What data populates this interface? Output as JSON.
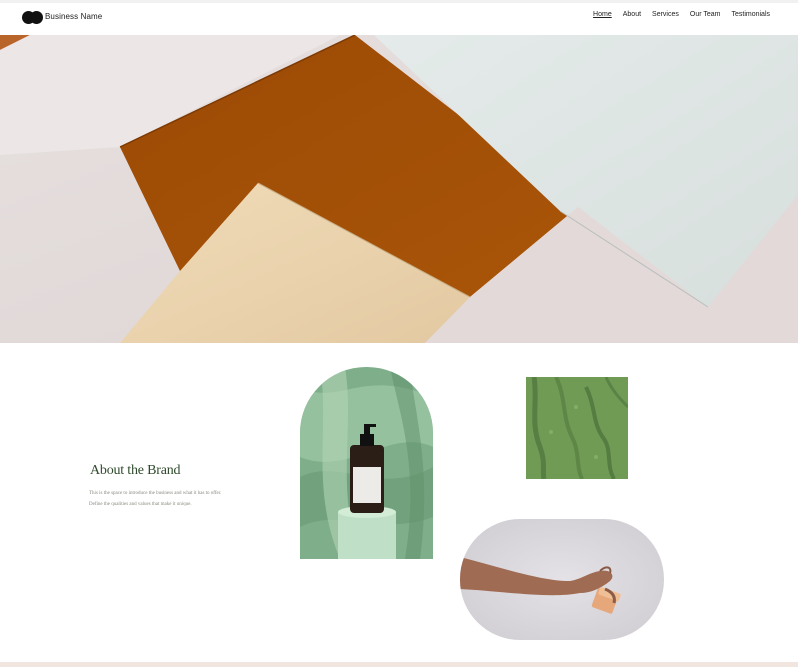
{
  "header": {
    "business_name": "Business Name",
    "nav": [
      {
        "label": "Home",
        "active": true
      },
      {
        "label": "About",
        "active": false
      },
      {
        "label": "Services",
        "active": false
      },
      {
        "label": "Our Team",
        "active": false
      },
      {
        "label": "Testimonials",
        "active": false
      }
    ]
  },
  "about": {
    "title": "About the Brand",
    "body_line1": "This is the space to introduce the business and what it has to offer.",
    "body_line2": "Define the qualities and values that make it unique."
  },
  "colors": {
    "heading_green": "#2f4a2c",
    "hero_orange": "#a6510a",
    "hero_cream": "#ead3ad",
    "hero_mint": "#dfe6e4",
    "accent_green": "#6f9b55"
  }
}
